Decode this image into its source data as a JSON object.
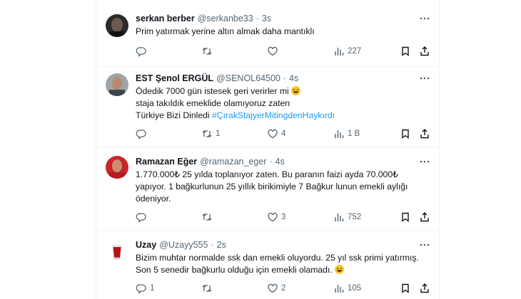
{
  "tweets": [
    {
      "name": "serkan berber",
      "handle": "@serkanbe33",
      "dot": "·",
      "time": "3s",
      "lines": [
        "Prim yatırmak  yerine altın almak daha mantıklı"
      ],
      "replies": "",
      "retweets": "",
      "likes": "",
      "views": "227"
    },
    {
      "name": "EST Şenol ERGÜL",
      "handle": "@SENOL64500",
      "dot": "·",
      "time": "4s",
      "lines": [
        "Ödedik 7000 gün istesek geri verirler mi",
        "staja takıldık emeklide olamıyoruz zaten"
      ],
      "last_line_prefix": "Türkiye Bizi Dinledi ",
      "hashtag": "#ÇırakStajyerMitingdenHaykırdı",
      "replies": "",
      "retweets": "1",
      "likes": "4",
      "views": "1 B"
    },
    {
      "name": "Ramazan Eğer",
      "handle": "@ramazan_eger",
      "dot": "·",
      "time": "4s",
      "lines": [
        "1.770.000₺ 25 yılda toplanıyor zaten. Bu paranın faizi ayda 70.000₺",
        "yapıyor. 1 bağkurlunun 25 yıllık birikimiyle 7 Bağkur lunun emekli aylığı",
        "ödeniyor."
      ],
      "replies": "",
      "retweets": "",
      "likes": "3",
      "views": "752"
    },
    {
      "name": "Uzay",
      "handle": "@Uzayy555",
      "dot": "·",
      "time": "2s",
      "lines": [
        "Bizim muhtar normalde ssk dan emekli oluyordu. 25 yıl ssk primi yatırmış.",
        "Son 5 senedir bağkurlu olduğu için emekli olamadı."
      ],
      "replies": "1",
      "retweets": "",
      "likes": "2",
      "views": "105"
    }
  ],
  "icons": {
    "reply": "reply-icon",
    "retweet": "retweet-icon",
    "like": "heart-icon",
    "views": "views-icon",
    "bookmark": "bookmark-icon",
    "share": "share-icon",
    "more": "more-icon"
  },
  "colors": {
    "text": "#0f1419",
    "muted": "#536471",
    "link": "#1d9bf0",
    "border": "#eff3f4"
  }
}
